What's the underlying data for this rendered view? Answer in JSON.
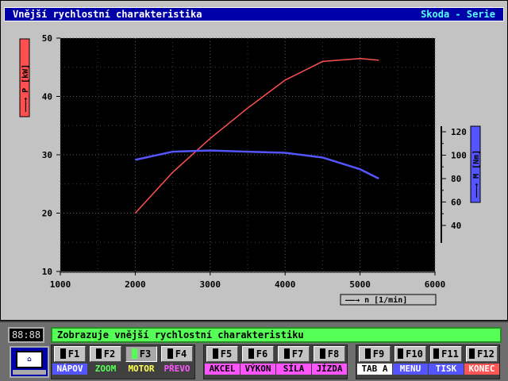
{
  "window": {
    "title": "Vnější rychlostní charakteristika",
    "title_right": "Skoda - Serie"
  },
  "chart_data": {
    "type": "line",
    "x": [
      2000,
      2500,
      3000,
      3500,
      4000,
      4500,
      5000,
      5250
    ],
    "series": [
      {
        "name": "P",
        "axis": "left",
        "color": "#ff5050",
        "values": [
          20.0,
          27.0,
          32.8,
          38.0,
          42.8,
          46.0,
          46.5,
          46.2
        ]
      },
      {
        "name": "M",
        "axis": "right",
        "color": "#5555ff",
        "values": [
          96,
          103,
          104,
          103,
          102,
          98,
          88,
          80
        ]
      }
    ],
    "xlim": [
      1000,
      6000
    ],
    "xticks": [
      "1000",
      "2000",
      "3000",
      "4000",
      "5000",
      "6000"
    ],
    "ylim_left": [
      10,
      50
    ],
    "yticks_left": [
      "10",
      "20",
      "30",
      "40",
      "50"
    ],
    "ylim_right": [
      40,
      120
    ],
    "yticks_right": [
      "40",
      "60",
      "80",
      "100",
      "120"
    ],
    "xlabel": "n [1/min]",
    "ylabel_left": "P [kW]",
    "ylabel_right": "M [Nm]",
    "grid": true,
    "background": "#000000"
  },
  "status": {
    "clock": "88:88",
    "message": "Zobrazuje vnější rychlostní charakteristiku"
  },
  "fkeys": [
    {
      "key": "F1",
      "label": "NÁPOV",
      "color": "#5555ff",
      "fg": "#ffffff",
      "led": false
    },
    {
      "key": "F2",
      "label": "ZOOM",
      "color": "#404040",
      "fg": "#55ff55",
      "led": false
    },
    {
      "key": "F3",
      "label": "MOTOR",
      "color": "#404040",
      "fg": "#ffff55",
      "led": true
    },
    {
      "key": "F4",
      "label": "PŘEVO",
      "color": "#404040",
      "fg": "#ff55ff",
      "led": false
    },
    {
      "key": "F5",
      "label": "AKCEL",
      "color": "#ff55ff",
      "fg": "#000000",
      "led": false
    },
    {
      "key": "F6",
      "label": "VÝKON",
      "color": "#ff55ff",
      "fg": "#000000",
      "led": false
    },
    {
      "key": "F7",
      "label": "SÍLA",
      "color": "#ff55ff",
      "fg": "#000000",
      "led": false
    },
    {
      "key": "F8",
      "label": "JÍZDA",
      "color": "#ff55ff",
      "fg": "#000000",
      "led": false
    },
    {
      "key": "F9",
      "label": "TAB A",
      "color": "#ffffff",
      "fg": "#000000",
      "led": false
    },
    {
      "key": "F10",
      "label": "MENU",
      "color": "#5555ff",
      "fg": "#ffffff",
      "led": false
    },
    {
      "key": "F11",
      "label": "TISK",
      "color": "#5555ff",
      "fg": "#ffffff",
      "led": false
    },
    {
      "key": "F12",
      "label": "KONEC",
      "color": "#ff5555",
      "fg": "#ffffff",
      "led": false
    }
  ]
}
